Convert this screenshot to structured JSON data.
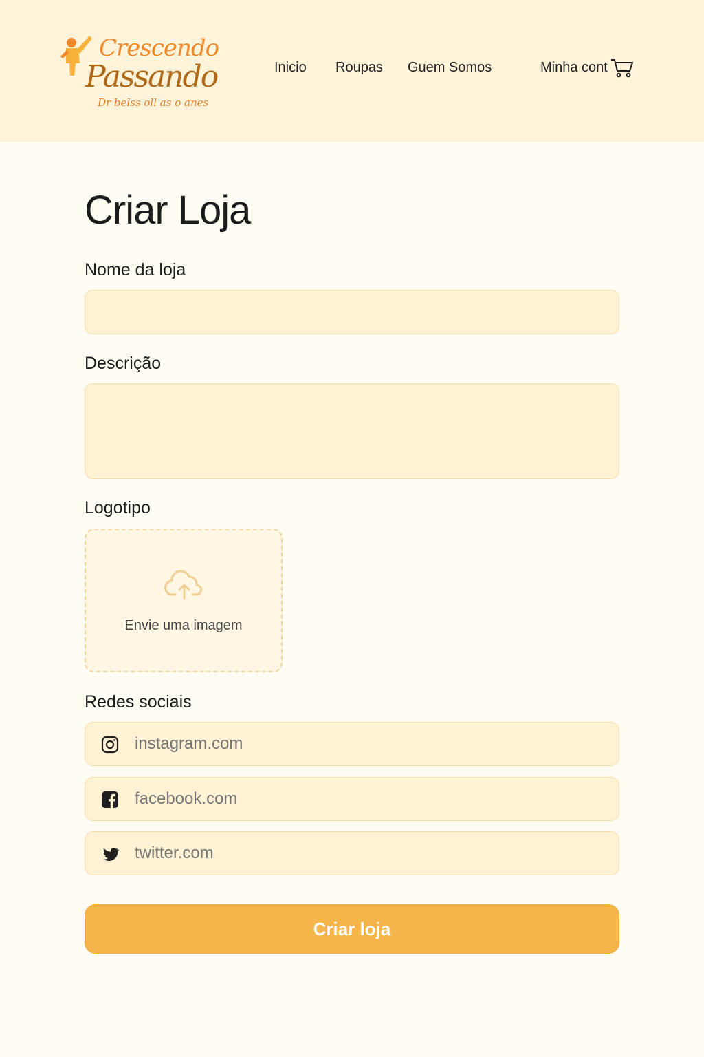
{
  "brand": {
    "line1": "Crescendo",
    "line2": "Passando",
    "tagline": "Dr belss oll as o anes",
    "colors": {
      "orange": "#f0892a",
      "brown": "#b06a1a",
      "header_bg": "#fff4d9"
    }
  },
  "nav": {
    "items": [
      {
        "label": "Inicio"
      },
      {
        "label": "Roupas"
      },
      {
        "label": "Guem Somos"
      },
      {
        "label": "Minha cont"
      }
    ],
    "cart_icon": "cart-icon"
  },
  "form": {
    "title": "Criar Loja",
    "name_label": "Nome da loja",
    "name_value": "",
    "description_label": "Descrição",
    "description_value": "",
    "logo_label": "Logotipo",
    "upload_text": "Envie uma imagem",
    "upload_icon": "cloud-upload-icon",
    "social_label": "Redes sociais",
    "social": [
      {
        "icon": "instagram-icon",
        "placeholder": "instagram.com"
      },
      {
        "icon": "facebook-icon",
        "placeholder": "facebook.com"
      },
      {
        "icon": "twitter-icon",
        "placeholder": "twitter.com"
      }
    ],
    "submit_label": "Criar loja",
    "accent": "#f5b54a",
    "field_bg": "#fff2d4"
  }
}
